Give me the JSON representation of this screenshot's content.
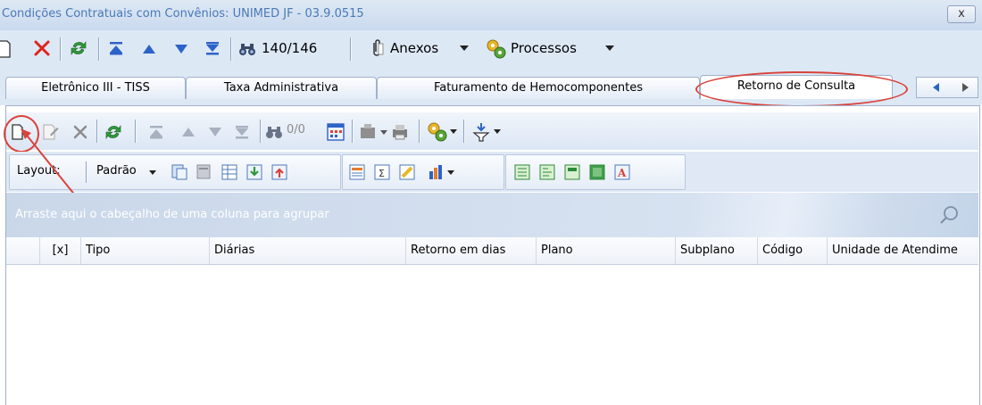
{
  "window": {
    "title": "Condições Contratuais com Convênios: UNIMED JF - 03.9.0515",
    "close_label": "x"
  },
  "main_toolbar": {
    "record_counter": "140/146",
    "anexos_label": "Anexos",
    "processos_label": "Processos"
  },
  "tabs": [
    {
      "label": "Eletrônico III - TISS"
    },
    {
      "label": "Taxa Administrativa"
    },
    {
      "label": "Faturamento de Hemocomponentes"
    },
    {
      "label": "Retorno de Consulta",
      "active": true
    }
  ],
  "sub_toolbar": {
    "record_counter": "0/0"
  },
  "layout_toolbar": {
    "layout_label": "Layout:",
    "layout_value": "Padrão"
  },
  "group_panel": {
    "hint": "Arraste aqui o cabeçalho de uma coluna para agrupar"
  },
  "grid": {
    "columns": [
      "[x]",
      "Tipo",
      "Diárias",
      "Retorno em dias",
      "Plano",
      "Subplano",
      "Código",
      "Unidade de Atendime"
    ]
  },
  "colors": {
    "accent_red": "#d9433b",
    "title_blue": "#4a79b8",
    "refresh_green": "#2f9a3a"
  }
}
